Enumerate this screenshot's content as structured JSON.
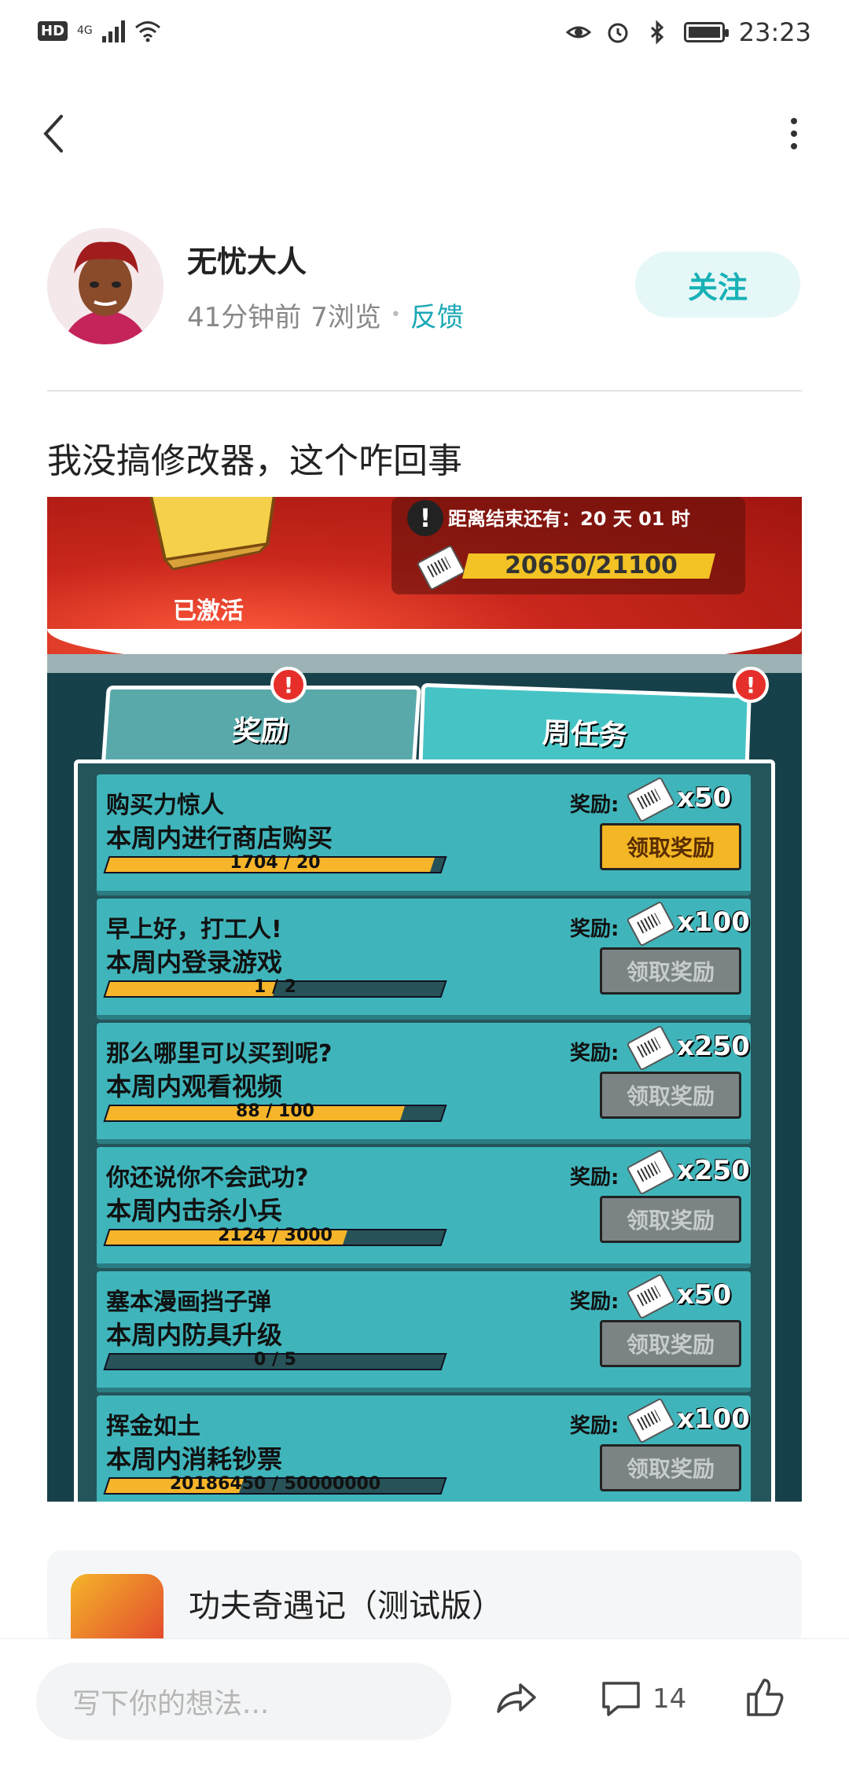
{
  "status_bar": {
    "hd_label": "HD",
    "network_label": "4G",
    "time": "23:23"
  },
  "author": {
    "name": "无忧大人",
    "time_ago": "41分钟前",
    "views": "7浏览",
    "feedback": "反馈",
    "follow_label": "关注"
  },
  "post": {
    "text": "我没搞修改器，这个咋回事"
  },
  "game_screenshot": {
    "activated": "已激活",
    "countdown": "距离结束还有：20 天 01 时",
    "progress": "20650/21100",
    "progress_fraction": 0.98,
    "tabs": [
      "奖励",
      "周任务"
    ],
    "tab_badge": "!",
    "reward_label": "奖励:",
    "tasks": [
      {
        "title": "购买力惊人",
        "sub": "本周内进行商店购买",
        "progress": "1704 / 20",
        "fill": 0.97,
        "reward": "x50",
        "button": "领取奖励",
        "active": true
      },
      {
        "title": "早上好，打工人!",
        "sub": "本周内登录游戏",
        "progress": "1 / 2",
        "fill": 0.5,
        "reward": "x100",
        "button": "领取奖励",
        "active": false
      },
      {
        "title": "那么哪里可以买到呢?",
        "sub": "本周内观看视频",
        "progress": "88 / 100",
        "fill": 0.88,
        "reward": "x250",
        "button": "领取奖励",
        "active": false
      },
      {
        "title": "你还说你不会武功?",
        "sub": "本周内击杀小兵",
        "progress": "2124 / 3000",
        "fill": 0.71,
        "reward": "x250",
        "button": "领取奖励",
        "active": false
      },
      {
        "title": "塞本漫画挡子弹",
        "sub": "本周内防具升级",
        "progress": "0 / 5",
        "fill": 0.0,
        "reward": "x50",
        "button": "领取奖励",
        "active": false
      },
      {
        "title": "挥金如土",
        "sub": "本周内消耗钞票",
        "progress": "20186450 / 50000000",
        "fill": 0.4,
        "reward": "x100",
        "button": "领取奖励",
        "active": false
      }
    ]
  },
  "game_card": {
    "name": "功夫奇遇记（测试版）"
  },
  "bottom_bar": {
    "input_placeholder": "写下你的想法...",
    "comment_count": "14"
  },
  "colors": {
    "accent": "#17b1b6",
    "follow_bg": "#e6f7f7",
    "task_bg": "#3fb5bb",
    "progress_yellow": "#f6b52a"
  }
}
